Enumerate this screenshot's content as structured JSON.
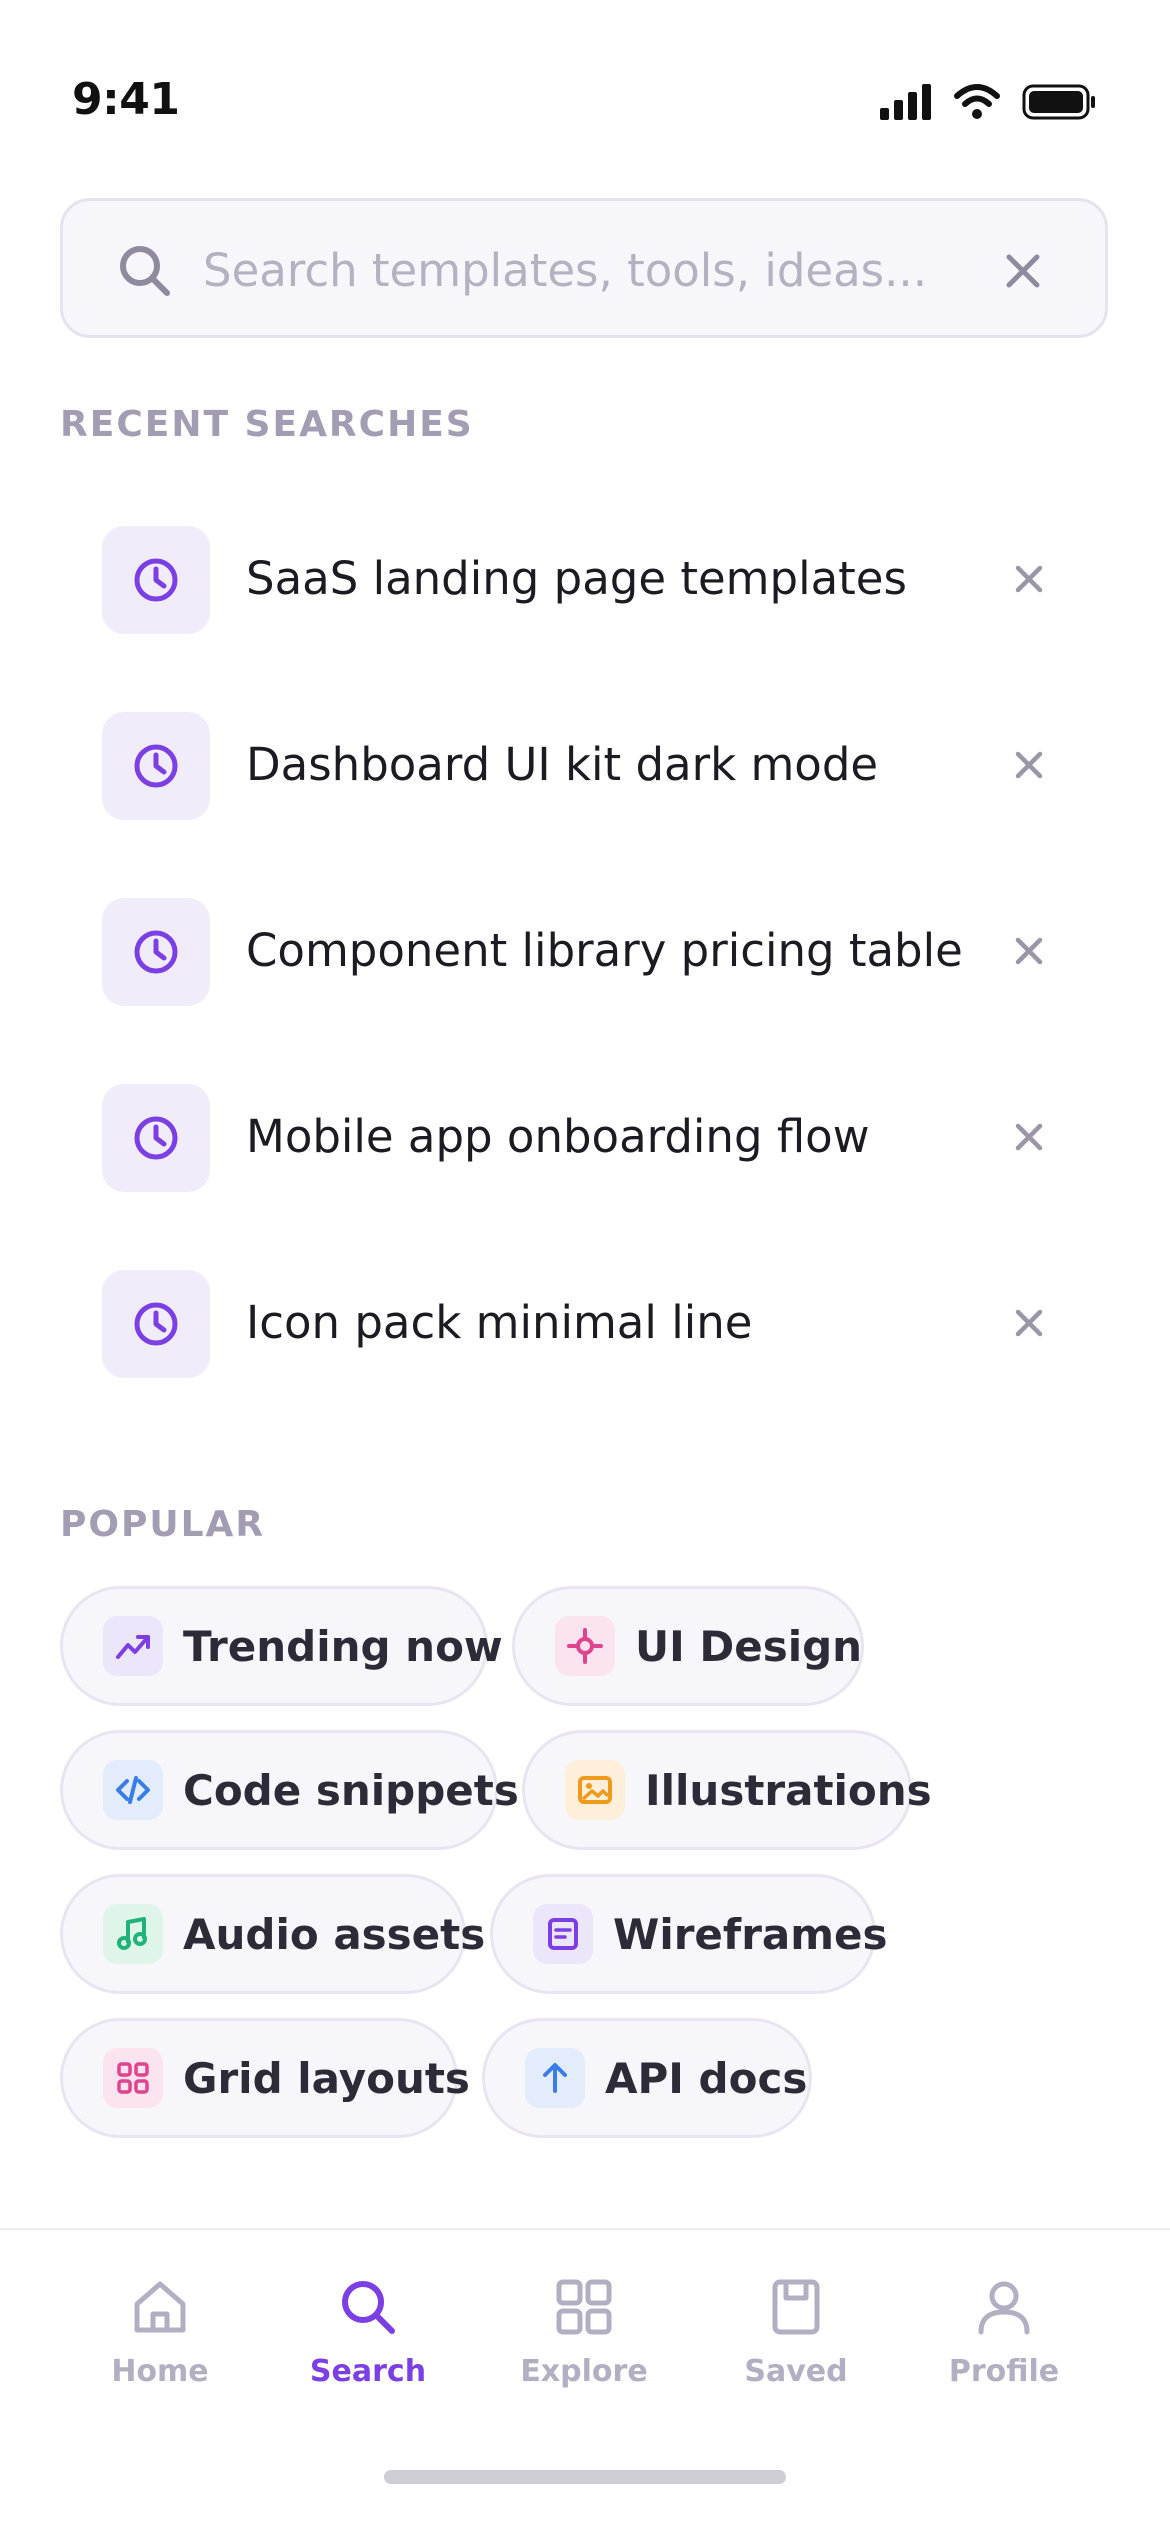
{
  "status_bar": {
    "time": "9:41"
  },
  "search": {
    "placeholder": "Search templates, tools, ideas..."
  },
  "recent": {
    "heading": "RECENT SEARCHES",
    "items": [
      {
        "label": "SaaS landing page templates"
      },
      {
        "label": "Dashboard UI kit dark mode"
      },
      {
        "label": "Component library pricing table"
      },
      {
        "label": "Mobile app onboarding flow"
      },
      {
        "label": "Icon pack minimal line"
      }
    ]
  },
  "popular": {
    "heading": "POPULAR",
    "chips": [
      {
        "label": "Trending now",
        "icon": "trending-up-icon",
        "color": "#7b3fe4",
        "bg": "#ece6fb"
      },
      {
        "label": "UI Design",
        "icon": "crosshair-icon",
        "color": "#e0448e",
        "bg": "#fbe4ef"
      },
      {
        "label": "Code snippets",
        "icon": "code-icon",
        "color": "#3b7de8",
        "bg": "#e3ecfb"
      },
      {
        "label": "Illustrations",
        "icon": "image-icon",
        "color": "#ef9a1a",
        "bg": "#fdefd9"
      },
      {
        "label": "Audio assets",
        "icon": "music-icon",
        "color": "#1fb37a",
        "bg": "#dff5ea"
      },
      {
        "label": "Wireframes",
        "icon": "document-icon",
        "color": "#7b3fe4",
        "bg": "#ece6fb"
      },
      {
        "label": "Grid layouts",
        "icon": "grid-icon",
        "color": "#e0448e",
        "bg": "#fbe4ef"
      },
      {
        "label": "API docs",
        "icon": "arrow-up-icon",
        "color": "#3b7de8",
        "bg": "#e3ecfb"
      }
    ]
  },
  "nav": {
    "items": [
      {
        "label": "Home",
        "icon": "home-icon"
      },
      {
        "label": "Search",
        "icon": "search-icon",
        "active": true
      },
      {
        "label": "Explore",
        "icon": "grid-icon"
      },
      {
        "label": "Saved",
        "icon": "bookmark-icon"
      },
      {
        "label": "Profile",
        "icon": "user-icon"
      }
    ]
  },
  "colors": {
    "accent": "#7b3fe4",
    "muted_text": "#a29db3",
    "inactive_nav": "#b3afc2"
  }
}
